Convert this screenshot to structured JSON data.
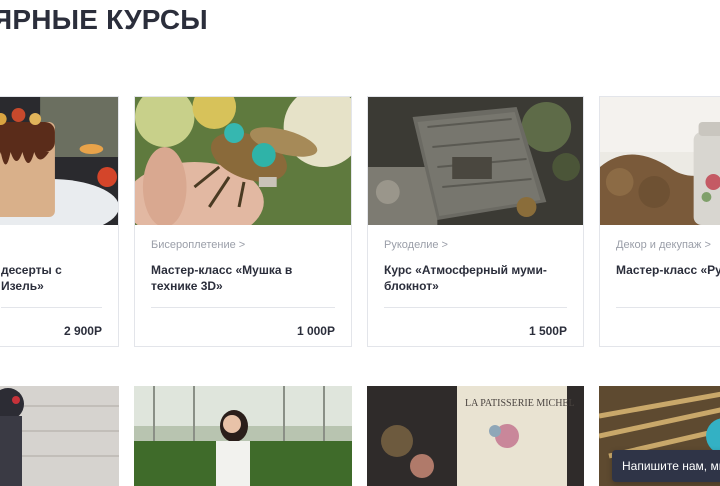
{
  "section": {
    "title": "ЯРНЫЕ КУРСЫ"
  },
  "courses": [
    {
      "category": "",
      "title": "десерты с Изель»",
      "price": "2 900Р"
    },
    {
      "category": "Бисероплетение >",
      "title": "Мастер-класс «Мушка в технике 3D»",
      "price": "1 000Р"
    },
    {
      "category": "Рукоделие >",
      "title": "Курс «Атмосферный муми-блокнот»",
      "price": "1 500Р"
    },
    {
      "category": "Декор и декупаж >",
      "title": "Мастер-класс «Рус",
      "price": ""
    }
  ],
  "chat": {
    "label": "Напишите нам, мы"
  }
}
